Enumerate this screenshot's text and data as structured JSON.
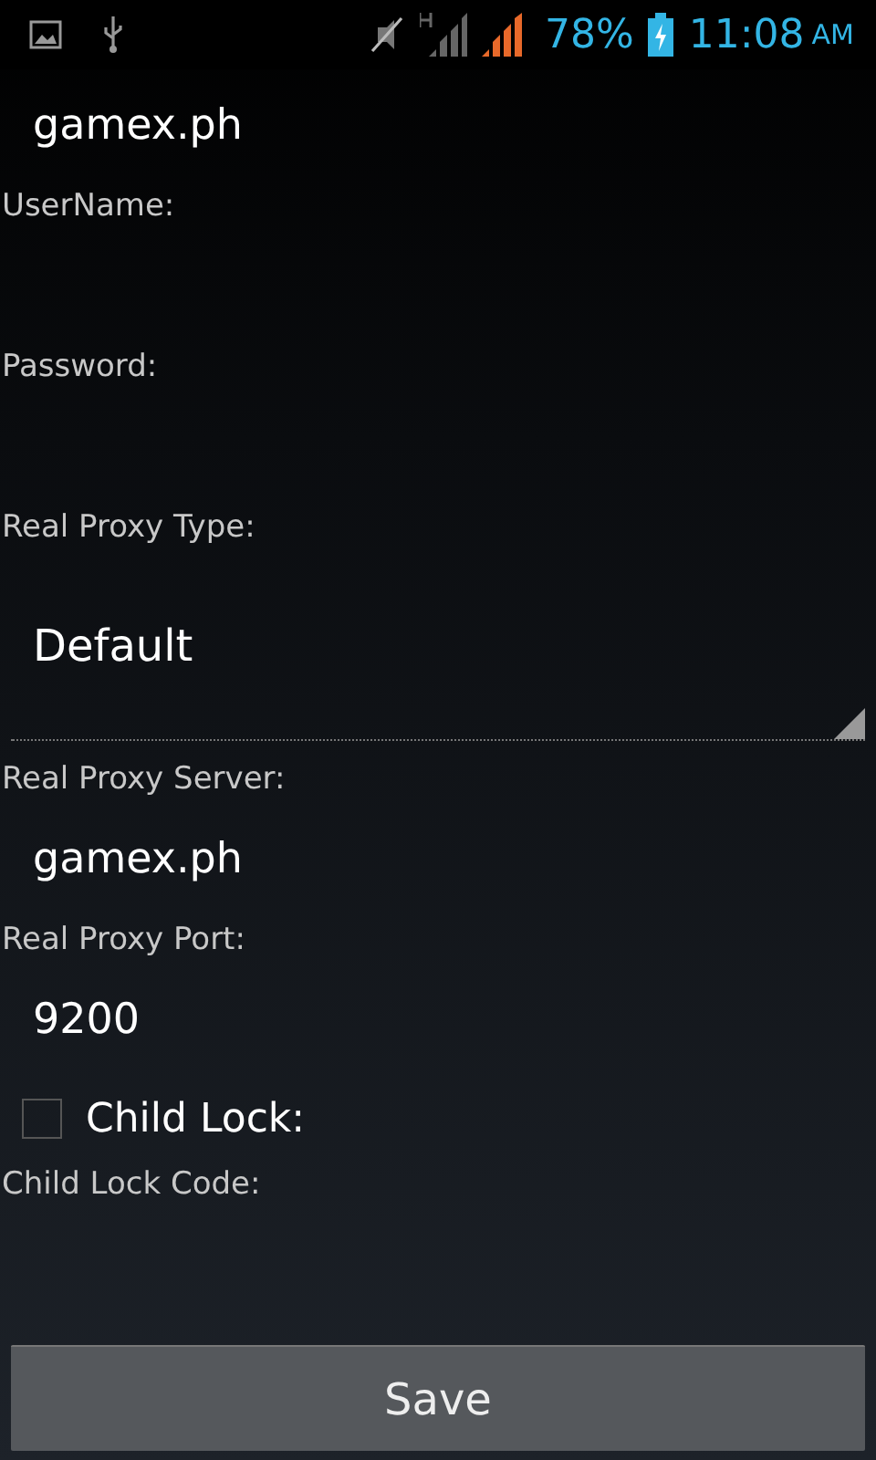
{
  "status_bar": {
    "battery": "78%",
    "time": "11:08",
    "meridiem": "AM"
  },
  "form": [
    {
      "kind": "field",
      "value": "gamex.ph"
    },
    {
      "kind": "label",
      "text": "UserName:"
    },
    {
      "kind": "field"
    },
    {
      "kind": "label",
      "text": "Password:"
    },
    {
      "kind": "field"
    },
    {
      "kind": "label",
      "text": "Real Proxy Type:"
    },
    {
      "kind": "spinner",
      "value": "Default"
    },
    {
      "kind": "label",
      "text": "Real Proxy Server:"
    },
    {
      "kind": "field",
      "value": "gamex.ph"
    },
    {
      "kind": "label",
      "text": "Real Proxy Port:"
    },
    {
      "kind": "field",
      "value": "9200"
    },
    {
      "kind": "checkbox",
      "text": "Child Lock:",
      "checked": false
    },
    {
      "kind": "label",
      "text": "Child Lock Code:"
    },
    {
      "kind": "field"
    }
  ],
  "buttons": [
    "Save"
  ]
}
